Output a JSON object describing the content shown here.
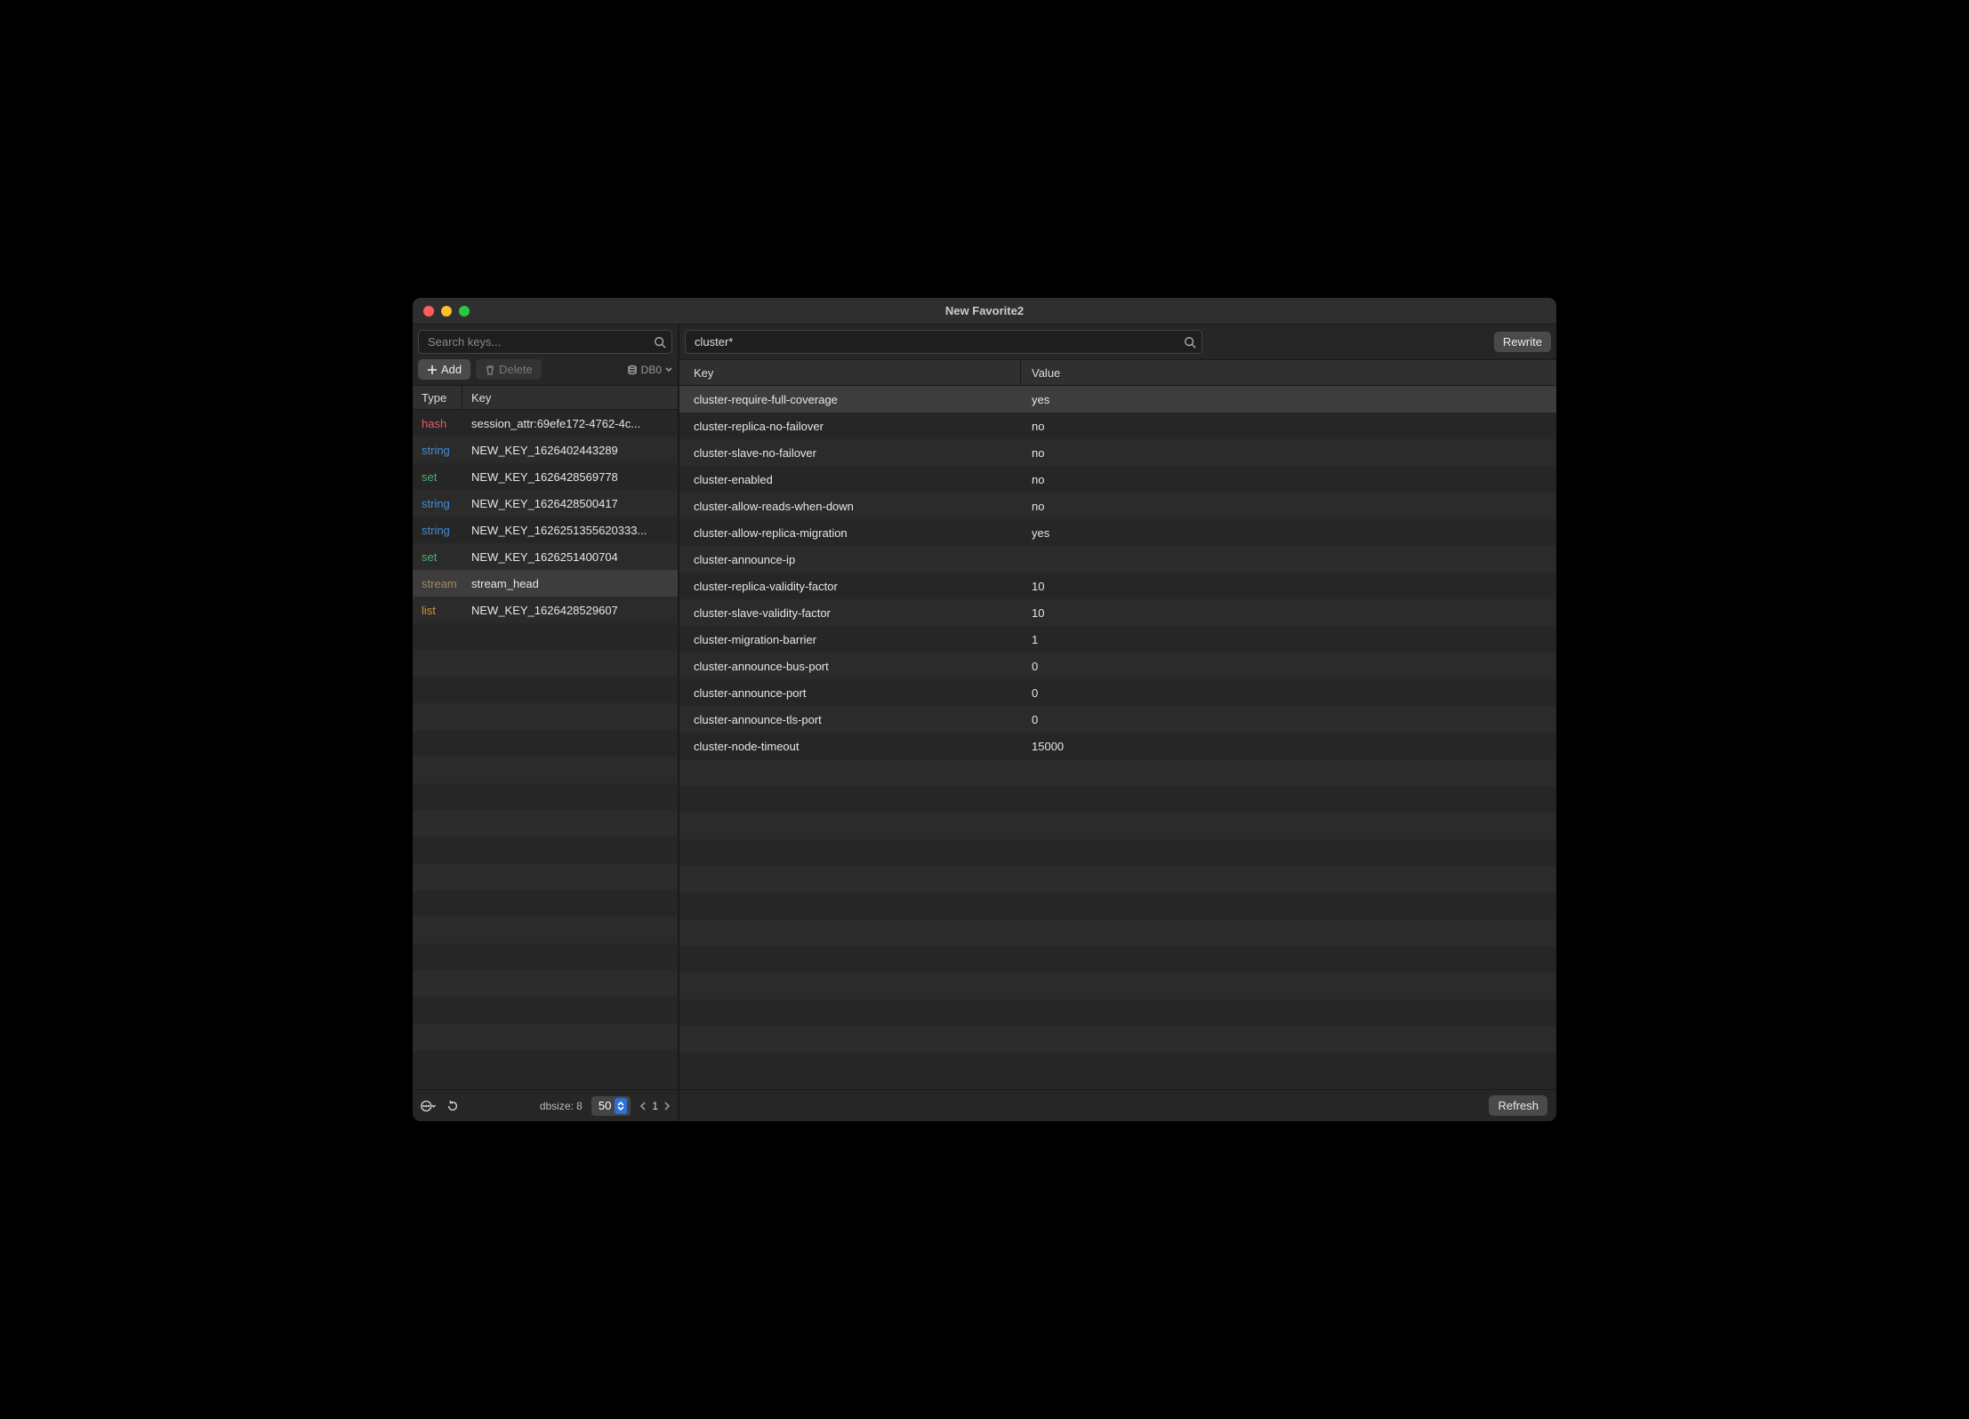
{
  "window": {
    "title": "New Favorite2"
  },
  "sidebar": {
    "search_placeholder": "Search keys...",
    "add_label": "Add",
    "delete_label": "Delete",
    "db_label": "DB0",
    "header": {
      "type": "Type",
      "key": "Key"
    },
    "keys": [
      {
        "type": "hash",
        "type_class": "t-hash",
        "name": "session_attr:69efe172-4762-4c..."
      },
      {
        "type": "string",
        "type_class": "t-string",
        "name": "NEW_KEY_1626402443289"
      },
      {
        "type": "set",
        "type_class": "t-set",
        "name": "NEW_KEY_1626428569778"
      },
      {
        "type": "string",
        "type_class": "t-string",
        "name": "NEW_KEY_1626428500417"
      },
      {
        "type": "string",
        "type_class": "t-string",
        "name": "NEW_KEY_1626251355620333..."
      },
      {
        "type": "set",
        "type_class": "t-set",
        "name": "NEW_KEY_1626251400704"
      },
      {
        "type": "stream",
        "type_class": "t-stream",
        "name": "stream_head",
        "selected": true
      },
      {
        "type": "list",
        "type_class": "t-list",
        "name": "NEW_KEY_1626428529607"
      }
    ],
    "footer": {
      "dbsize_label": "dbsize: 8",
      "page_size": "50",
      "page": "1"
    }
  },
  "main": {
    "filter_value": "cluster*",
    "rewrite_label": "Rewrite",
    "refresh_label": "Refresh",
    "header": {
      "key": "Key",
      "value": "Value"
    },
    "rows": [
      {
        "k": "cluster-require-full-coverage",
        "v": "yes",
        "selected": true
      },
      {
        "k": "cluster-replica-no-failover",
        "v": "no"
      },
      {
        "k": "cluster-slave-no-failover",
        "v": "no"
      },
      {
        "k": "cluster-enabled",
        "v": "no"
      },
      {
        "k": "cluster-allow-reads-when-down",
        "v": "no"
      },
      {
        "k": "cluster-allow-replica-migration",
        "v": "yes"
      },
      {
        "k": "cluster-announce-ip",
        "v": ""
      },
      {
        "k": "cluster-replica-validity-factor",
        "v": "10"
      },
      {
        "k": "cluster-slave-validity-factor",
        "v": "10"
      },
      {
        "k": "cluster-migration-barrier",
        "v": "1"
      },
      {
        "k": "cluster-announce-bus-port",
        "v": "0"
      },
      {
        "k": "cluster-announce-port",
        "v": "0"
      },
      {
        "k": "cluster-announce-tls-port",
        "v": "0"
      },
      {
        "k": "cluster-node-timeout",
        "v": "15000"
      }
    ]
  }
}
